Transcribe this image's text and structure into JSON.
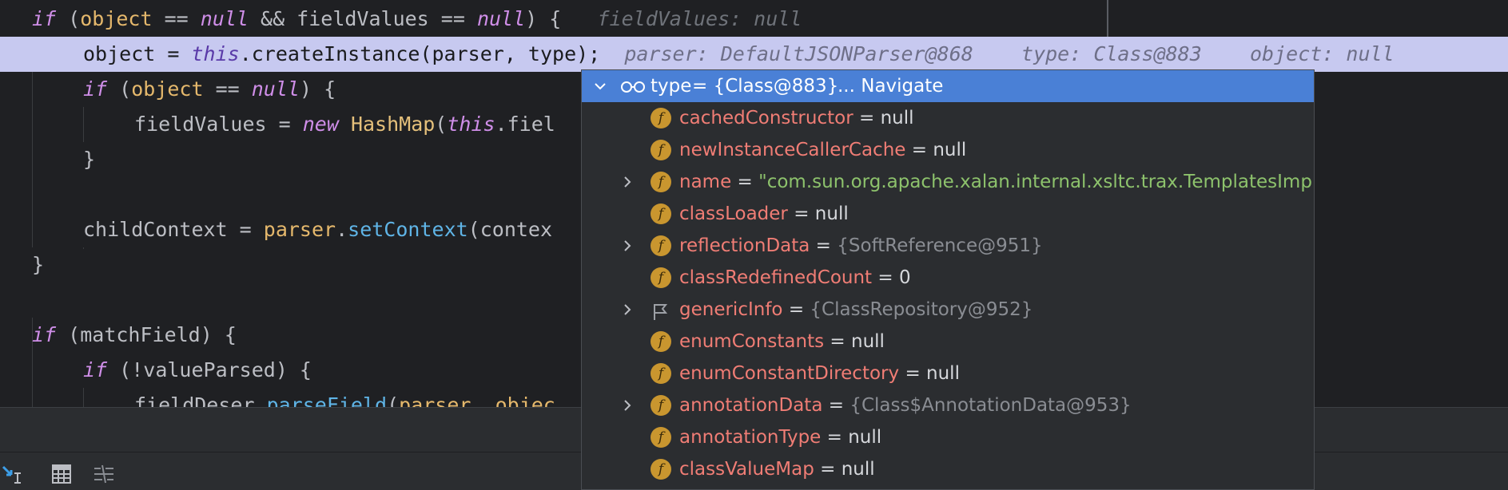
{
  "editor": {
    "lines": [
      {
        "tokens": [
          [
            "kw",
            "if"
          ],
          [
            "tx",
            " ("
          ],
          [
            "var",
            "object"
          ],
          [
            "tx",
            " == "
          ],
          [
            "nul",
            "null"
          ],
          [
            "tx",
            " && fieldValues == "
          ],
          [
            "nul",
            "null"
          ],
          [
            "tx",
            ") {  "
          ],
          [
            "hint",
            " fieldValues: null"
          ]
        ]
      },
      {
        "tokens": [
          [
            "tx",
            "object = "
          ],
          [
            "kw",
            "this"
          ],
          [
            "tx",
            ".createInstance(parser, type);  "
          ],
          [
            "hint",
            "parser: DefaultJSONParser@868    type: Class@883    object: null"
          ]
        ]
      },
      {
        "tokens": [
          [
            "kw",
            "if"
          ],
          [
            "tx",
            " ("
          ],
          [
            "var",
            "object"
          ],
          [
            "tx",
            " == "
          ],
          [
            "nul",
            "null"
          ],
          [
            "tx",
            ") {"
          ]
        ]
      },
      {
        "tokens": [
          [
            "tx",
            "fieldValues = "
          ],
          [
            "kw",
            "new"
          ],
          [
            "tx",
            " "
          ],
          [
            "ty",
            "HashMap"
          ],
          [
            "tx",
            "("
          ],
          [
            "kw",
            "this"
          ],
          [
            "tx",
            ".fiel"
          ]
        ]
      },
      {
        "tokens": [
          [
            "tx",
            "}"
          ]
        ]
      },
      {
        "tokens": []
      },
      {
        "tokens": [
          [
            "tx",
            "childContext = "
          ],
          [
            "var",
            "parser"
          ],
          [
            "tx",
            "."
          ],
          [
            "fn",
            "setContext"
          ],
          [
            "tx",
            "(contex"
          ]
        ]
      },
      {
        "tokens": [
          [
            "tx",
            "}"
          ]
        ]
      },
      {
        "tokens": []
      },
      {
        "tokens": [
          [
            "kw",
            "if"
          ],
          [
            "tx",
            " (matchField) {"
          ]
        ]
      },
      {
        "tokens": [
          [
            "kw",
            "if"
          ],
          [
            "tx",
            " (!valueParsed) {"
          ]
        ]
      },
      {
        "tokens": [
          [
            "tx",
            "fieldDeser."
          ],
          [
            "fn",
            "parseField"
          ],
          [
            "tx",
            "("
          ],
          [
            "var",
            "parser"
          ],
          [
            "tx",
            ", "
          ],
          [
            "var",
            "objec"
          ]
        ]
      }
    ]
  },
  "popup": {
    "header": {
      "name": "type",
      "value": "= {Class@883}",
      "action": "... Navigate"
    },
    "rows": [
      {
        "icon": "field",
        "expandable": false,
        "name": "cachedConstructor",
        "value": "null",
        "kind": "plain"
      },
      {
        "icon": "field",
        "expandable": false,
        "name": "newInstanceCallerCache",
        "value": "null",
        "kind": "plain"
      },
      {
        "icon": "field",
        "expandable": true,
        "name": "name",
        "value": "\"com.sun.org.apache.xalan.internal.xsltc.trax.TemplatesImpl\"",
        "kind": "string"
      },
      {
        "icon": "field",
        "expandable": false,
        "name": "classLoader",
        "value": "null",
        "kind": "plain"
      },
      {
        "icon": "field",
        "expandable": true,
        "name": "reflectionData",
        "value": "{SoftReference@951}",
        "kind": "ref"
      },
      {
        "icon": "field",
        "expandable": false,
        "name": "classRedefinedCount",
        "value": "0",
        "kind": "plain"
      },
      {
        "icon": "flag",
        "expandable": true,
        "name": "genericInfo",
        "value": "{ClassRepository@952}",
        "kind": "ref"
      },
      {
        "icon": "field",
        "expandable": false,
        "name": "enumConstants",
        "value": "null",
        "kind": "plain"
      },
      {
        "icon": "field",
        "expandable": false,
        "name": "enumConstantDirectory",
        "value": "null",
        "kind": "plain"
      },
      {
        "icon": "field",
        "expandable": true,
        "name": "annotationData",
        "value": "{Class$AnnotationData@953}",
        "kind": "ref"
      },
      {
        "icon": "field",
        "expandable": false,
        "name": "annotationType",
        "value": "null",
        "kind": "plain"
      },
      {
        "icon": "field",
        "expandable": false,
        "name": "classValueMap",
        "value": "null",
        "kind": "plain"
      }
    ],
    "field_badge": "f",
    "equals": "="
  },
  "toolbar": {
    "icons": [
      "step-cursor-icon",
      "calculator-icon",
      "columns-icon"
    ]
  },
  "colors": {
    "accent": "#4a80d6",
    "highlight_line": "#c7c9f0",
    "field_name": "#f07d75",
    "string_value": "#8dc26c"
  }
}
